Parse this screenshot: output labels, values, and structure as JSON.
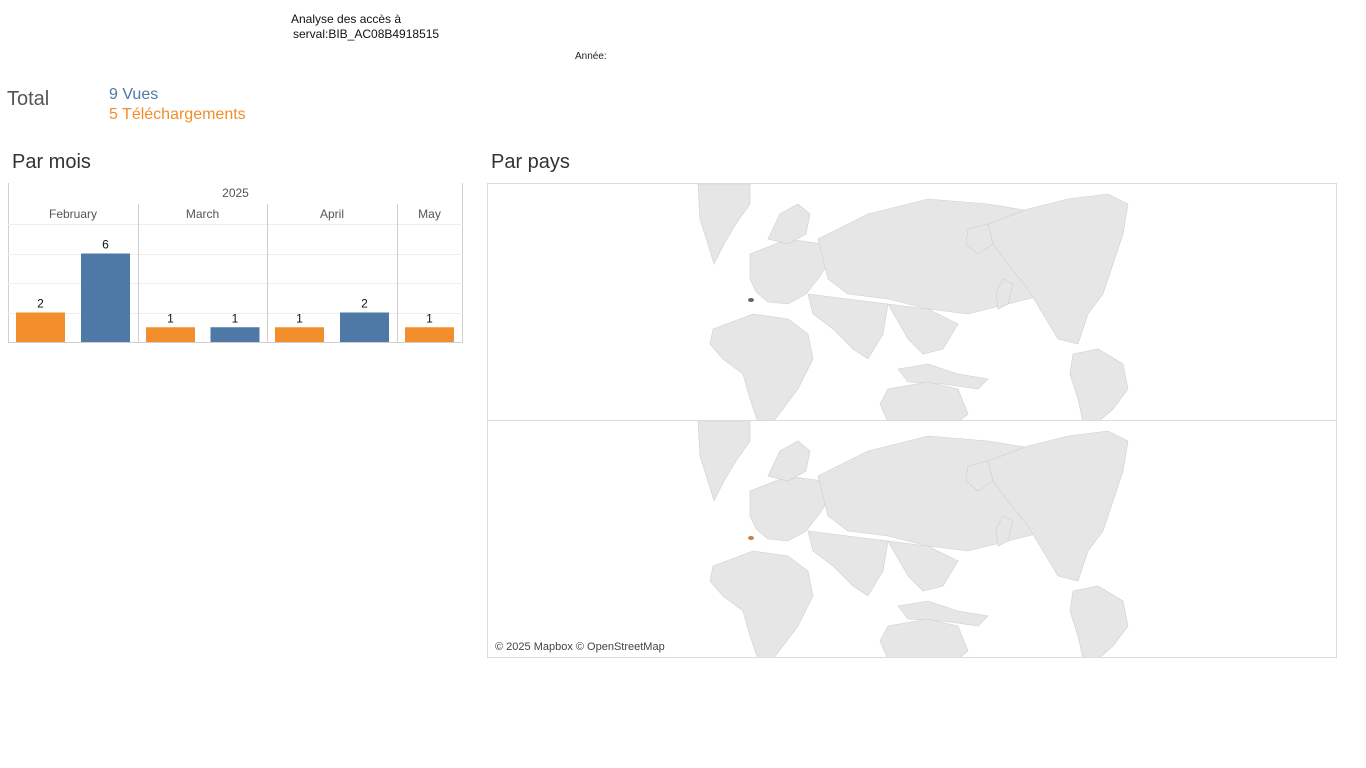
{
  "header": {
    "title_line1": "Analyse des accès à",
    "title_line2": "serval:BIB_AC08B4918515",
    "year_filter_label": "Année:"
  },
  "totals": {
    "label": "Total",
    "views": "9 Vues",
    "downloads": "5 Téléchargements"
  },
  "sections": {
    "by_month": "Par mois",
    "by_country": "Par pays"
  },
  "colors": {
    "views": "#4e79a7",
    "downloads": "#f28e2b",
    "land": "#e6e6e6",
    "highlight_views": "#666666",
    "highlight_downloads": "#c9804a"
  },
  "chart_data": {
    "type": "bar",
    "year": "2025",
    "categories": [
      "February",
      "March",
      "April",
      "May"
    ],
    "series": [
      {
        "key": "downloads",
        "values": [
          2,
          1,
          1,
          1
        ]
      },
      {
        "key": "views",
        "values": [
          6,
          1,
          2,
          null
        ]
      }
    ],
    "ylim": [
      0,
      8
    ],
    "grid": true
  },
  "map": {
    "attribution": "© 2025 Mapbox © OpenStreetMap",
    "panels": [
      "views",
      "downloads"
    ],
    "highlighted_country": "Switzerland"
  }
}
